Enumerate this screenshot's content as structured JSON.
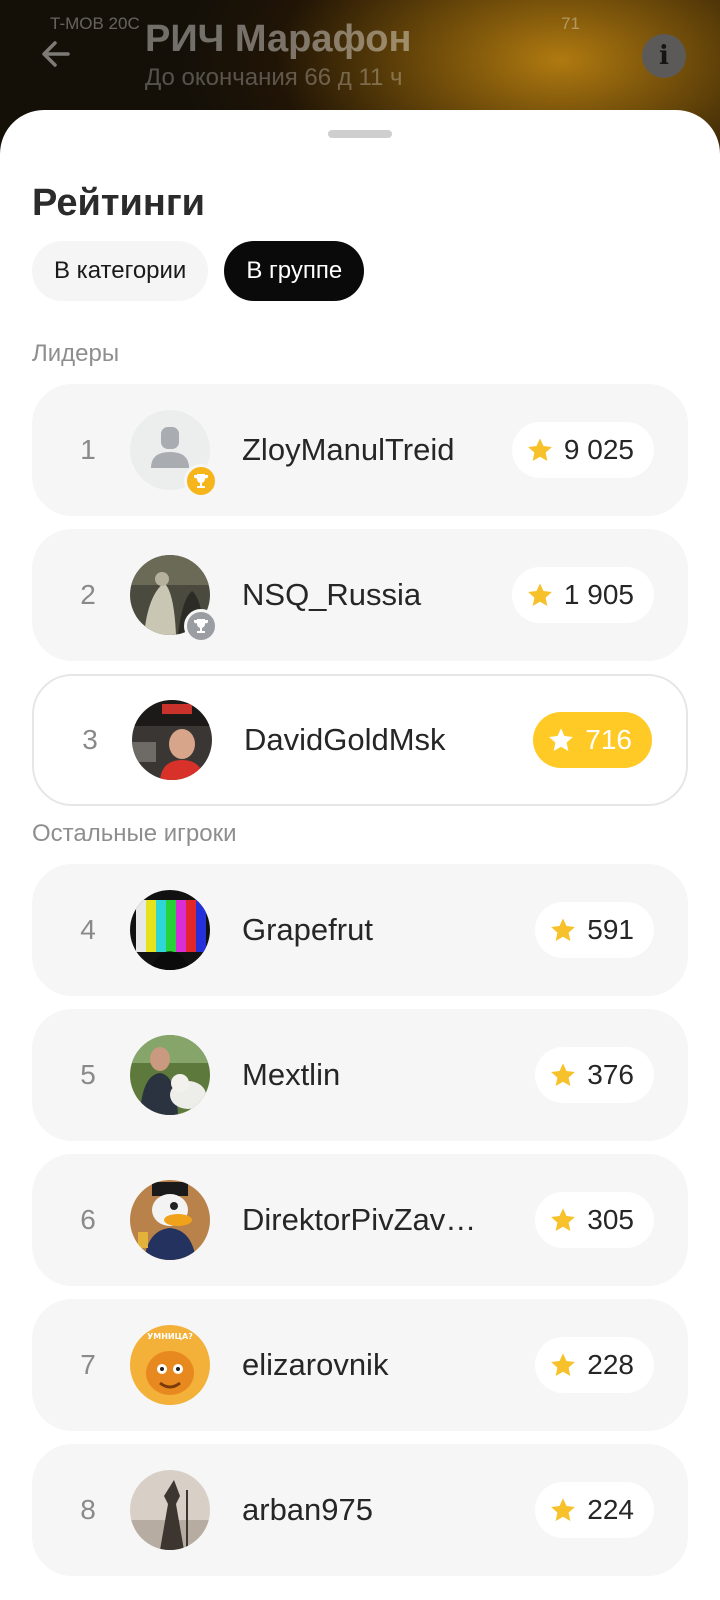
{
  "status": {
    "carrier": "T-MOB 20C",
    "battery": "71"
  },
  "header": {
    "title": "РИЧ Марафон",
    "subtitle": "До окончания 66 д 11 ч",
    "info_icon": "info-icon",
    "back_icon": "arrow-left-icon"
  },
  "sheet": {
    "title": "Рейтинги",
    "tabs": [
      {
        "label": "В категории",
        "active": false
      },
      {
        "label": "В группе",
        "active": true
      }
    ],
    "leaders_label": "Лидеры",
    "others_label": "Остальные игроки"
  },
  "colors": {
    "accent": "#ffc926",
    "star": "#f7c12b",
    "gold": "#f7b51c",
    "silver": "#9a9ea3"
  },
  "leaders": [
    {
      "rank": "1",
      "name": "ZloyManulTreid",
      "score": "9 025",
      "trophy": "gold",
      "avatar": "placeholder"
    },
    {
      "rank": "2",
      "name": "NSQ_Russia",
      "score": "1 905",
      "trophy": "silver",
      "avatar": "painting"
    },
    {
      "rank": "3",
      "name": "DavidGoldMsk",
      "score": "716",
      "trophy": "",
      "avatar": "photo",
      "highlighted": true
    }
  ],
  "players": [
    {
      "rank": "4",
      "name": "Grapefrut",
      "score": "591",
      "avatar": "test-pattern"
    },
    {
      "rank": "5",
      "name": "Mextlin",
      "score": "376",
      "avatar": "photo-dog"
    },
    {
      "rank": "6",
      "name": "DirektorPivZav…",
      "score": "305",
      "avatar": "duck"
    },
    {
      "rank": "7",
      "name": "elizarovnik",
      "score": "228",
      "avatar": "cat",
      "avatar_text": "УМНИЦА?"
    },
    {
      "rank": "8",
      "name": "arban975",
      "score": "224",
      "avatar": "wizard"
    }
  ]
}
